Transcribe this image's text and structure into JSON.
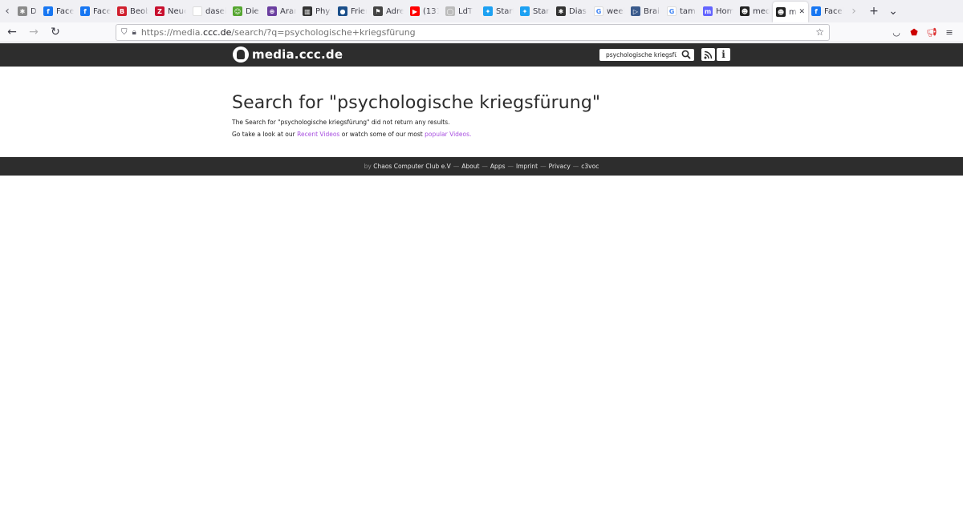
{
  "browser": {
    "tabs": [
      {
        "title": "Diasp",
        "icon": "diaspora-icon",
        "color": "#8a8a8a",
        "glyph": "✱"
      },
      {
        "title": "Facebook",
        "icon": "facebook-icon",
        "color": "#1877f2",
        "glyph": "f"
      },
      {
        "title": "Facebook",
        "icon": "facebook-icon",
        "color": "#1877f2",
        "glyph": "f"
      },
      {
        "title": "Beobachter",
        "icon": "beobachter-icon",
        "color": "#d0202e",
        "glyph": "B"
      },
      {
        "title": "Neue Zürcher",
        "icon": "nzz-icon",
        "color": "#c8102e",
        "glyph": "Z"
      },
      {
        "title": "daseinsgrund",
        "icon": "blank-icon",
        "color": "#ffffff",
        "glyph": ""
      },
      {
        "title": "Die E",
        "icon": "green-icon",
        "color": "#55a630",
        "glyph": "☺"
      },
      {
        "title": "Aram",
        "icon": "globe-icon",
        "color": "#6b3fa0",
        "glyph": "⊕"
      },
      {
        "title": "Phys",
        "icon": "phys-icon",
        "color": "#333333",
        "glyph": "▥"
      },
      {
        "title": "Friends",
        "icon": "steam-icon",
        "color": "#1b4f8a",
        "glyph": "●"
      },
      {
        "title": "Adresse",
        "icon": "flag-icon",
        "color": "#444444",
        "glyph": "⚑"
      },
      {
        "title": "(131)",
        "icon": "youtube-icon",
        "color": "#ff0000",
        "glyph": "▶"
      },
      {
        "title": "LdT",
        "icon": "circle-icon",
        "color": "#bbbbbb",
        "glyph": "◯"
      },
      {
        "title": "Start",
        "icon": "twitter-icon",
        "color": "#1da1f2",
        "glyph": "✦"
      },
      {
        "title": "Start",
        "icon": "twitter-icon",
        "color": "#1da1f2",
        "glyph": "✦"
      },
      {
        "title": "Diasp",
        "icon": "diaspora-icon",
        "color": "#333333",
        "glyph": "✱"
      },
      {
        "title": "weekly",
        "icon": "google-icon",
        "color": "#ffffff",
        "glyph": "G"
      },
      {
        "title": "Brain",
        "icon": "brain-icon",
        "color": "#3a5a8c",
        "glyph": "▷"
      },
      {
        "title": "tampon",
        "icon": "google-icon",
        "color": "#ffffff",
        "glyph": "G"
      },
      {
        "title": "Home",
        "icon": "mastodon-icon",
        "color": "#6364ff",
        "glyph": "m"
      },
      {
        "title": "media",
        "icon": "ccc-icon",
        "color": "#222222",
        "glyph": "☻"
      },
      {
        "title": "media",
        "icon": "ccc-icon",
        "color": "#222222",
        "glyph": "☻",
        "active": true
      },
      {
        "title": "Facebook",
        "icon": "facebook-icon",
        "color": "#1877f2",
        "glyph": "f"
      }
    ],
    "url_prefix": "https://media.",
    "url_domain": "ccc.de",
    "url_path": "/search/?q=psychologische+kriegsfürung"
  },
  "site": {
    "name": "media.ccc.de",
    "search_value": "psychologische kriegsfü",
    "info_label": "i"
  },
  "main": {
    "heading": "Search for \"psychologische kriegsfürung\"",
    "no_results": "The Search for \"psychologische kriegsfürung\" did not return any results.",
    "suggest_prefix": "Go take a look at our",
    "recent_link": "Recent Videos",
    "suggest_middle": "or watch some of our most",
    "popular_link": "popular Videos."
  },
  "footer": {
    "by": "by",
    "ccc": "Chaos Computer Club e.V",
    "sep": "—",
    "about": "About",
    "apps": "Apps",
    "imprint": "Imprint",
    "privacy": "Privacy",
    "c3voc": "c3voc"
  },
  "colors": {
    "header_bg": "#2d2d2d",
    "link": "#a84fe0"
  }
}
